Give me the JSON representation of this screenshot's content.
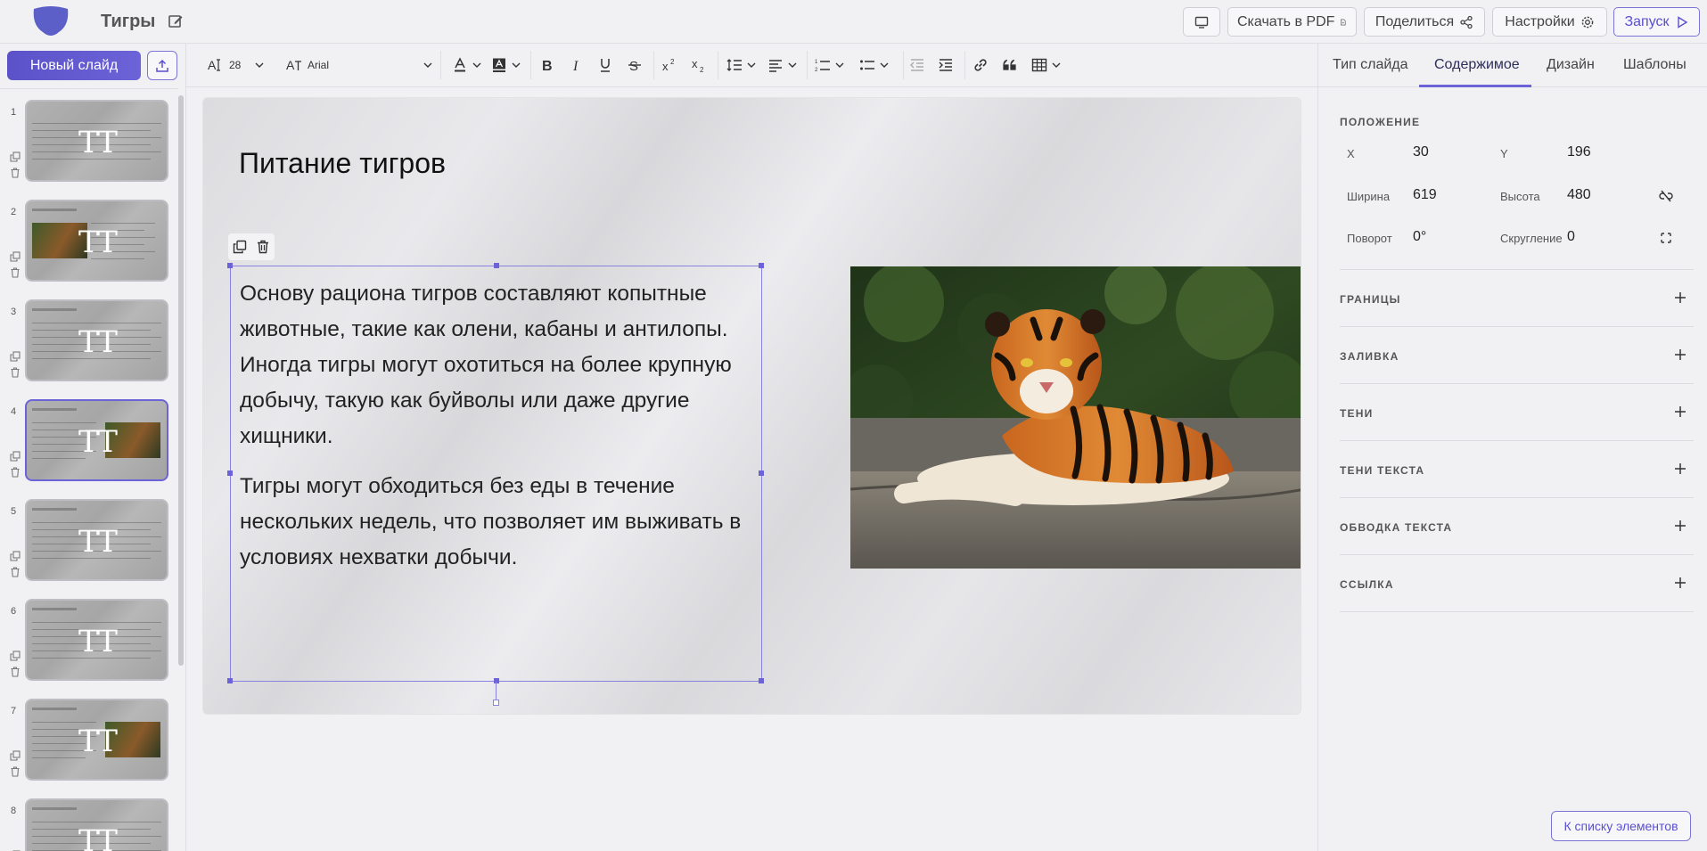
{
  "app": {
    "doc_title": "Тигры"
  },
  "header": {
    "present_icon": "monitor-icon",
    "download_pdf": "Скачать в PDF",
    "share": "Поделиться",
    "settings": "Настройки",
    "launch": "Запуск"
  },
  "left": {
    "new_slide": "Новый слайд",
    "slides": [
      {
        "num": "1",
        "heading": "",
        "has_image": false,
        "active": false
      },
      {
        "num": "2",
        "heading": "Описание и вид тигров",
        "has_image": true,
        "active": false
      },
      {
        "num": "3",
        "heading": "Распространение тигров",
        "has_image": false,
        "active": false
      },
      {
        "num": "4",
        "heading": "Питание тигров",
        "has_image": true,
        "active": true
      },
      {
        "num": "5",
        "heading": "Размножение тигров",
        "has_image": false,
        "active": false
      },
      {
        "num": "6",
        "heading": "Угрозы для популяции тигров",
        "has_image": false,
        "active": false
      },
      {
        "num": "7",
        "heading": "Сохранение популяции тигров",
        "has_image": true,
        "active": false
      },
      {
        "num": "8",
        "heading": "Роль тигров в экосистеме",
        "has_image": false,
        "active": false
      }
    ]
  },
  "toolbar": {
    "font_size": "28",
    "font_family": "Arial"
  },
  "slide": {
    "title": "Питание тигров",
    "paragraph1": "Основу рациона тигров составляют копытные животные, такие как олени, кабаны и антилопы. Иногда тигры могут охотиться на более крупную добычу, такую как буйволы или даже другие хищники.",
    "paragraph2": "Тигры могут обходиться без еды в течение нескольких недель, что позволяет им выживать в условиях нехватки добычи."
  },
  "right": {
    "tabs": [
      "Тип слайда",
      "Содержимое",
      "Дизайн",
      "Шаблоны"
    ],
    "active_tab": "Содержимое",
    "position_title": "ПОЛОЖЕНИЕ",
    "x_label": "X",
    "x_value": "30",
    "y_label": "Y",
    "y_value": "196",
    "width_label": "Ширина",
    "width_value": "619",
    "height_label": "Высота",
    "height_value": "480",
    "rotation_label": "Поворот",
    "rotation_value": "0°",
    "radius_label": "Скругление",
    "radius_value": "0",
    "sections": [
      "ГРАНИЦЫ",
      "ЗАЛИВКА",
      "ТЕНИ",
      "ТЕНИ ТЕКСТА",
      "ОБВОДКА ТЕКСТА",
      "ССЫЛКА"
    ],
    "to_list": "К списку элементов"
  },
  "colors": {
    "accent": "#6d63d8",
    "accent_dark": "#5a4fd0"
  }
}
